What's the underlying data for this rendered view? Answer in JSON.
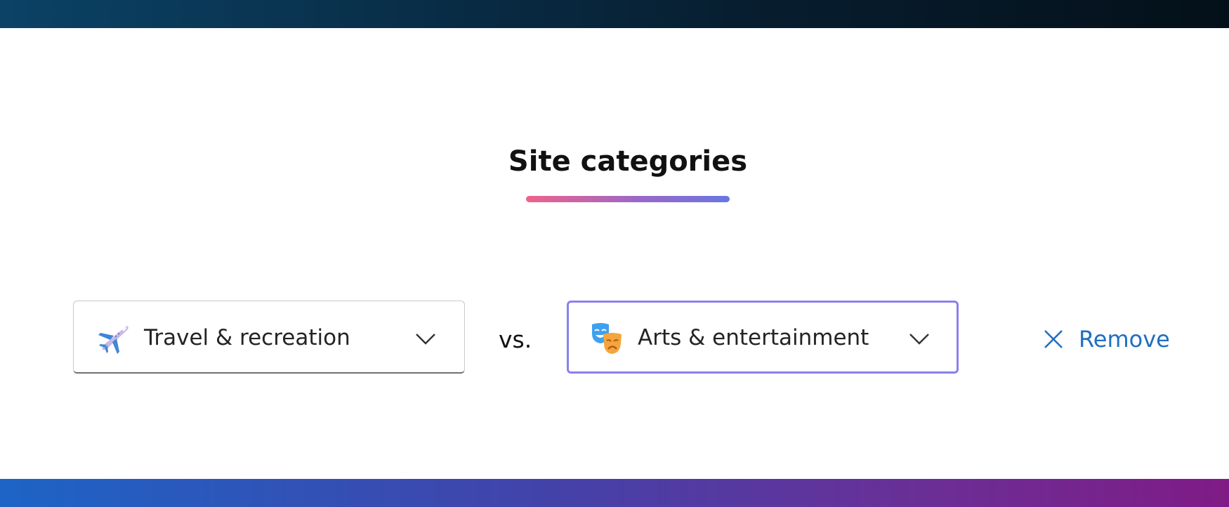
{
  "section": {
    "title": "Site categories"
  },
  "comparison": {
    "left": {
      "label": "Travel & recreation",
      "icon": "airplane-icon"
    },
    "separator": "vs.",
    "right": {
      "label": "Arts & entertainment",
      "icon": "theater-masks-icon"
    },
    "remove_label": "Remove"
  },
  "colors": {
    "accent_border": "#8b80ee",
    "link_blue": "#1f6fc2",
    "underline_start": "#f0628a",
    "underline_end": "#6876e2"
  }
}
